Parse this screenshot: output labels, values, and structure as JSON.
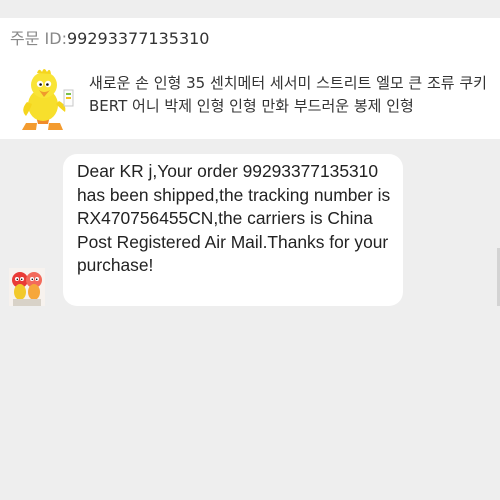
{
  "order": {
    "label": "주문 ID:",
    "id": "99293377135310"
  },
  "product": {
    "title": "새로운 손 인형 35 센치메터 세서미 스트리트 엘모 큰 조류 쿠키 BERT 어니 박제 인형 인형 만화 부드러운 봉제 인형",
    "thumbnail_icon": "yellow-bird-plush-icon"
  },
  "message": {
    "text": "Dear KR j,Your order 99293377135310 has been shipped,the tracking number is RX470756455CN,the carriers is China Post Registered Air Mail.Thanks for your purchase!",
    "avatar_icon": "seller-avatar-icon"
  },
  "colors": {
    "background": "#eeeeee",
    "card": "#ffffff",
    "text": "#222222",
    "label": "#888888"
  }
}
